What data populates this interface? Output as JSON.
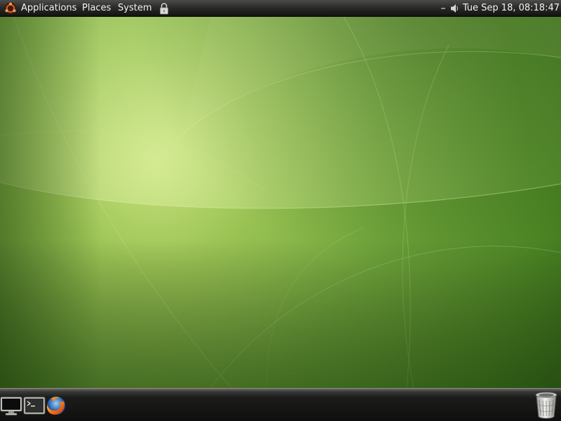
{
  "top_panel": {
    "menus": [
      {
        "label": "Applications"
      },
      {
        "label": "Places"
      },
      {
        "label": "System"
      }
    ],
    "icons": {
      "logo": "ubuntu-logo-icon",
      "lock": "lock-icon",
      "tray": "notification-icon",
      "volume": "volume-icon"
    },
    "clock": "Tue Sep 18, 08:18:47"
  },
  "bottom_panel": {
    "launchers": [
      {
        "name": "show-desktop-icon"
      },
      {
        "name": "terminal-icon"
      },
      {
        "name": "firefox-icon"
      }
    ],
    "trash": "trash-icon"
  },
  "colors": {
    "panel": "#1c1c1b",
    "panel_text": "#f4f4f2",
    "wallpaper_dark": "#2f5d12",
    "wallpaper_mid": "#6ea33a",
    "wallpaper_light": "#c6e27a",
    "ubuntu_orange": "#e25b1a"
  }
}
